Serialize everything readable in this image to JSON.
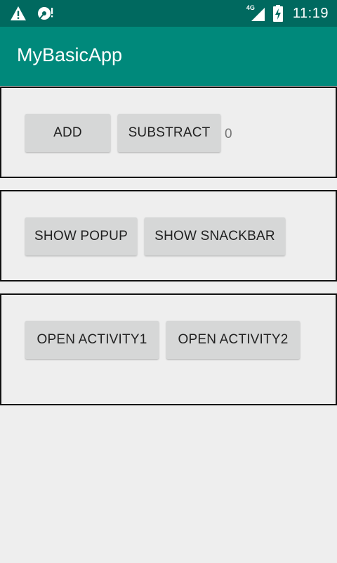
{
  "status_bar": {
    "time": "11:19",
    "network_label": "4G",
    "icons": [
      "warning-icon",
      "sd-card-alert-icon",
      "signal-icon",
      "battery-charging-icon"
    ],
    "colors": {
      "background": "#00695f"
    }
  },
  "app_bar": {
    "title": "MyBasicApp",
    "colors": {
      "background": "#00897b"
    }
  },
  "panel1": {
    "add_label": "ADD",
    "subtract_label": "SUBSTRACT",
    "counter": "0"
  },
  "panel2": {
    "popup_label": "SHOW POPUP",
    "snackbar_label": "SHOW SNACKBAR"
  },
  "panel3": {
    "activity1_label": "OPEN ACTIVITY1",
    "activity2_label": "OPEN ACTIVITY2"
  }
}
